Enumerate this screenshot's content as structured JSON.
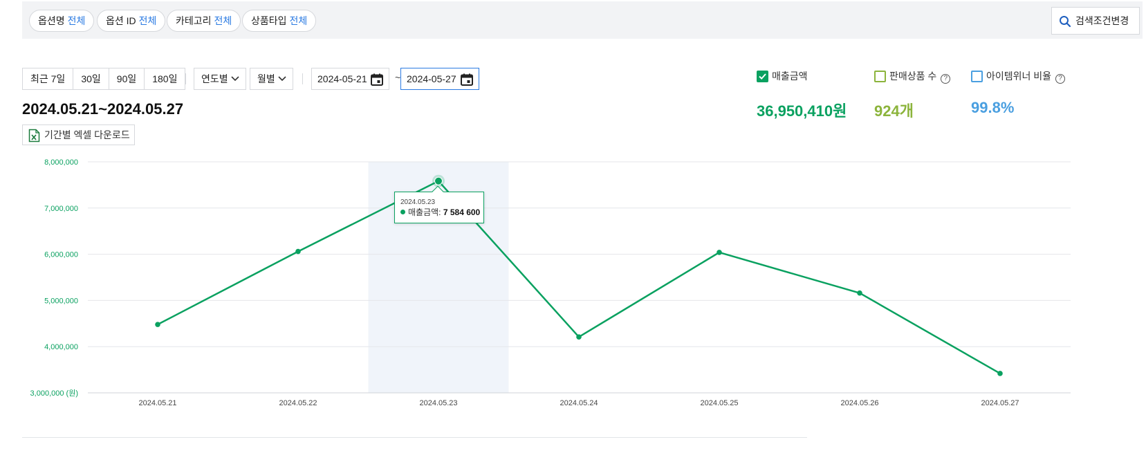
{
  "filters": {
    "chips": [
      {
        "label": "옵션명",
        "value": "전체"
      },
      {
        "label": "옵션 ID",
        "value": "전체"
      },
      {
        "label": "카테고리",
        "value": "전체"
      },
      {
        "label": "상품타입",
        "value": "전체"
      }
    ],
    "search_button": "검색조건변경"
  },
  "period": {
    "presets": [
      "최근 7일",
      "30일",
      "90일",
      "180일"
    ],
    "year_select": "연도별",
    "month_select": "월별",
    "start_date": "2024-05-21",
    "separator": "~",
    "end_date": "2024-05-27"
  },
  "summary": {
    "range_title": "2024.05.21~2024.05.27",
    "excel_button": "기간별 엑셀 다운로드",
    "metrics": [
      {
        "label": "매출금액",
        "checked": true,
        "value": "36,950,410원",
        "color": "#0aa160"
      },
      {
        "label": "판매상품 수",
        "checked": false,
        "value": "924개",
        "color": "#8cb43c"
      },
      {
        "label": "아이템위너 비율",
        "checked": false,
        "value": "99.8%",
        "color": "#4a9fe0"
      }
    ]
  },
  "tooltip": {
    "date": "2024.05.23",
    "series_label": "매출금액:",
    "value": "7 584 600"
  },
  "chart_data": {
    "type": "line",
    "x": [
      "2024.05.21",
      "2024.05.22",
      "2024.05.23",
      "2024.05.24",
      "2024.05.25",
      "2024.05.26",
      "2024.05.27"
    ],
    "series": [
      {
        "name": "매출금액",
        "values": [
          4480000,
          6060000,
          7584600,
          4210000,
          6040000,
          5160000,
          3420000
        ]
      }
    ],
    "ylim": [
      3000000,
      8000000
    ],
    "yticks": [
      {
        "value": 8000000,
        "label": "8,000,000"
      },
      {
        "value": 7000000,
        "label": "7,000,000"
      },
      {
        "value": 6000000,
        "label": "6,000,000"
      },
      {
        "value": 5000000,
        "label": "5,000,000"
      },
      {
        "value": 4000000,
        "label": "4,000,000"
      },
      {
        "value": 3000000,
        "label": "3,000,000 (원)"
      }
    ],
    "highlighted_category": "2024.05.23",
    "grid": true,
    "line_color": "#0aa160",
    "highlight_color": "#f0f4fa"
  }
}
